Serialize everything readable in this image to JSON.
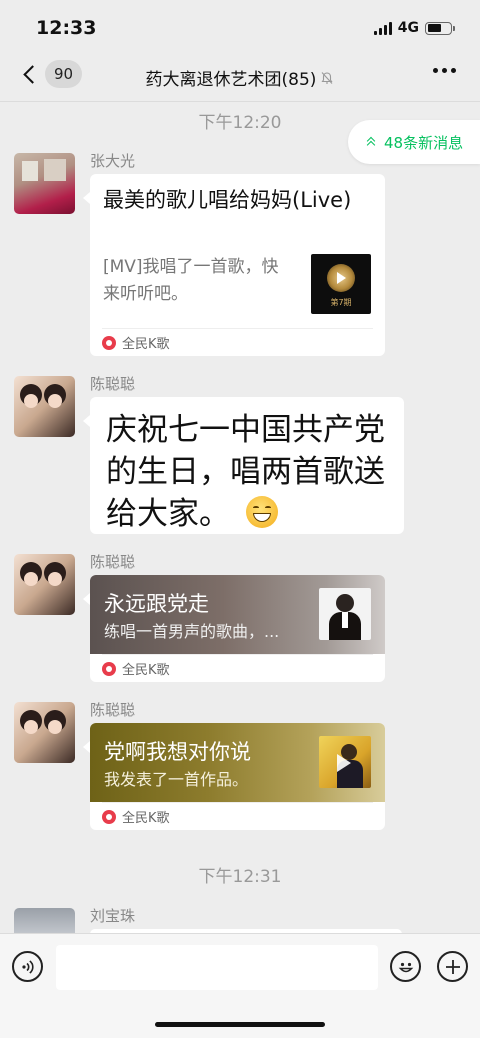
{
  "status_bar": {
    "time": "12:33",
    "network": "4G"
  },
  "nav": {
    "back_count": "90",
    "title": "药大离退休艺术团(85)"
  },
  "new_messages": {
    "label": "48条新消息"
  },
  "timestamps": [
    "下午12:20",
    "下午12:31"
  ],
  "messages": [
    {
      "sender": "张大光",
      "type": "card",
      "title": "最美的歌儿唱给妈妈(Live)",
      "desc": "[MV]我唱了一首歌，快来听听吧。",
      "thumb_label": "第7期",
      "source": "全民K歌"
    },
    {
      "sender": "陈聪聪",
      "type": "text",
      "text": "庆祝七一中国共产党的生日，唱两首歌送给大家。",
      "emoji": "grinning-sweat-emoji"
    },
    {
      "sender": "陈聪聪",
      "type": "card",
      "title": "永远跟党走",
      "desc": "练唱一首男声的歌曲，...",
      "source": "全民K歌"
    },
    {
      "sender": "陈聪聪",
      "type": "card",
      "title": "党啊我想对你说",
      "desc": "我发表了一首作品。",
      "source": "全民K歌"
    },
    {
      "sender": "刘宝珠",
      "type": "partial"
    }
  ],
  "colors": {
    "accent_green": "#07c160",
    "background": "#ededed",
    "ksong_red": "#e83c4b"
  }
}
